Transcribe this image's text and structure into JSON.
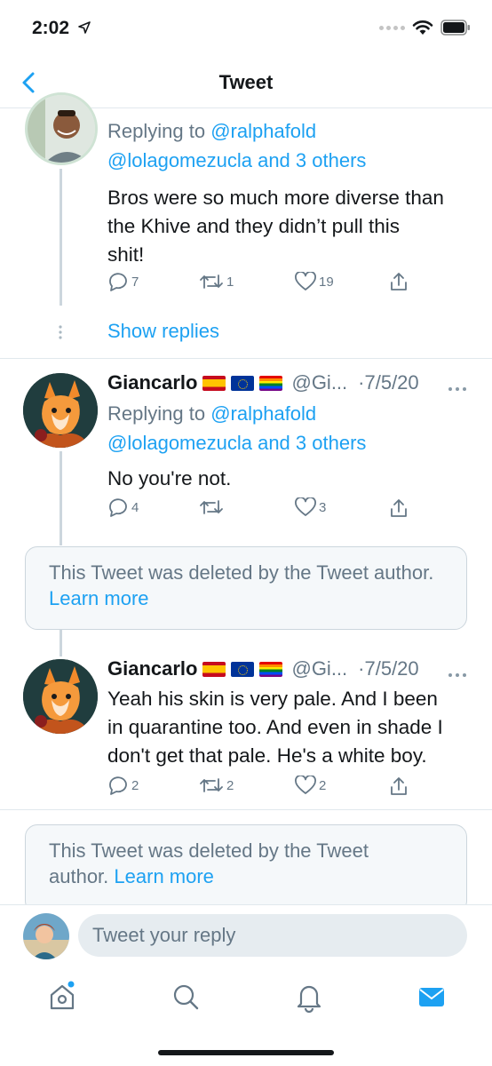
{
  "status_bar": {
    "time": "2:02"
  },
  "nav": {
    "title": "Tweet"
  },
  "tweet1": {
    "reply_prefix": "Replying to",
    "reply_handle": "@ralphafold",
    "reply_others": "@lolagomezucla and 3 others",
    "body_lines": [
      "Bros were so much more diverse than",
      "the Khive and they didn’t pull this",
      "shit!"
    ],
    "replies": "7",
    "retweets": "1",
    "likes": "19",
    "show_replies": "Show replies"
  },
  "tweet2": {
    "name": "Giancarlo",
    "handle": "@Gi...",
    "date": "·7/5/20",
    "reply_prefix": "Replying to",
    "reply_handle": "@ralphafold",
    "reply_others": "@lolagomezucla and 3 others",
    "body": "No you're not.",
    "replies": "4",
    "retweets": "",
    "likes": "3"
  },
  "deleted1": {
    "text": "This Tweet was deleted by the Tweet author.",
    "link": "Learn more"
  },
  "tweet3": {
    "name": "Giancarlo",
    "handle": "@Gi...",
    "date": "·7/5/20",
    "body_lines": [
      "Yeah his skin is very pale. And I been",
      "in quarantine too. And even in shade I",
      "don't get that pale. He's a white boy."
    ],
    "replies": "2",
    "retweets": "2",
    "likes": "2"
  },
  "deleted2": {
    "text": "This Tweet was deleted by the Tweet",
    "text2": "author.",
    "link": "Learn more"
  },
  "reply_bar": {
    "placeholder": "Tweet your reply"
  },
  "tabs": [
    "home-icon",
    "search-icon",
    "notifications-icon",
    "messages-icon"
  ],
  "colors": {
    "accent": "#1da1f2",
    "secondary_text": "#657786",
    "divider": "#e1e8ed"
  }
}
